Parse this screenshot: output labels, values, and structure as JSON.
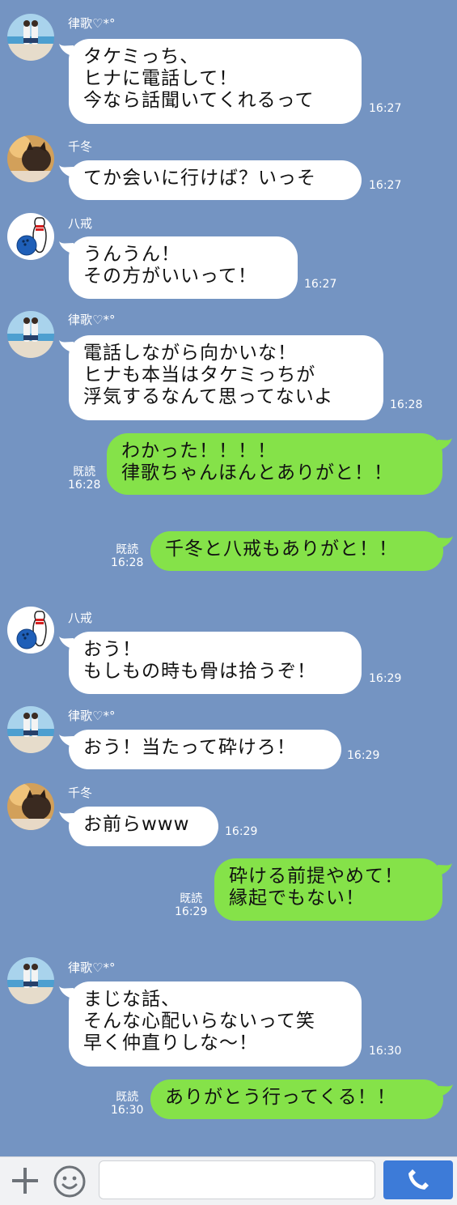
{
  "messages": [
    {
      "side": "in",
      "sender": "律歌♡*°",
      "avatar": "photo-avatar",
      "lines": "タケミっち、\nヒナに電話して！\n今なら話聞いてくれるって",
      "time": "16:27"
    },
    {
      "side": "in",
      "sender": "千冬",
      "avatar": "cat-avatar",
      "lines": "てか会いに行けば？いっそ",
      "time": "16:27"
    },
    {
      "side": "in",
      "sender": "八戒",
      "avatar": "bowling-avatar",
      "lines": "うんうん！\nその方がいいって！",
      "time": "16:27"
    },
    {
      "side": "in",
      "sender": "律歌♡*°",
      "avatar": "photo-avatar",
      "lines": "電話しながら向かいな！\nヒナも本当はタケミっちが\n浮気するなんて思ってないよ",
      "time": "16:28"
    },
    {
      "side": "out",
      "lines": "わかった！！！！\n律歌ちゃんほんとありがと！！",
      "read": "既読",
      "time": "16:28"
    },
    {
      "side": "out",
      "lines": "千冬と八戒もありがと！！",
      "read": "既読",
      "time": "16:28"
    },
    {
      "side": "in",
      "sender": "八戒",
      "avatar": "bowling-avatar",
      "lines": "おう！\nもしもの時も骨は拾うぞ！",
      "time": "16:29"
    },
    {
      "side": "in",
      "sender": "律歌♡*°",
      "avatar": "photo-avatar",
      "lines": "おう！当たって砕けろ！",
      "time": "16:29"
    },
    {
      "side": "in",
      "sender": "千冬",
      "avatar": "cat-avatar",
      "lines": "お前らwww",
      "time": "16:29"
    },
    {
      "side": "out",
      "lines": "砕ける前提やめて！\n縁起でもない！",
      "read": "既読",
      "time": "16:29"
    },
    {
      "side": "in",
      "sender": "律歌♡*°",
      "avatar": "photo-avatar",
      "lines": "まじな話、\nそんな心配いらないって笑\n早く仲直りしな〜！",
      "time": "16:30"
    },
    {
      "side": "out",
      "lines": "ありがとう行ってくる！！",
      "read": "既読",
      "time": "16:30"
    }
  ],
  "input_bar": {
    "plus_icon": "plus-icon",
    "emoji_icon": "smiley-icon",
    "placeholder": "",
    "call_icon": "phone-icon"
  },
  "colors": {
    "background": "#7494c2",
    "incoming_bubble": "#ffffff",
    "outgoing_bubble": "#85e249",
    "call_button": "#3d7bd8"
  }
}
